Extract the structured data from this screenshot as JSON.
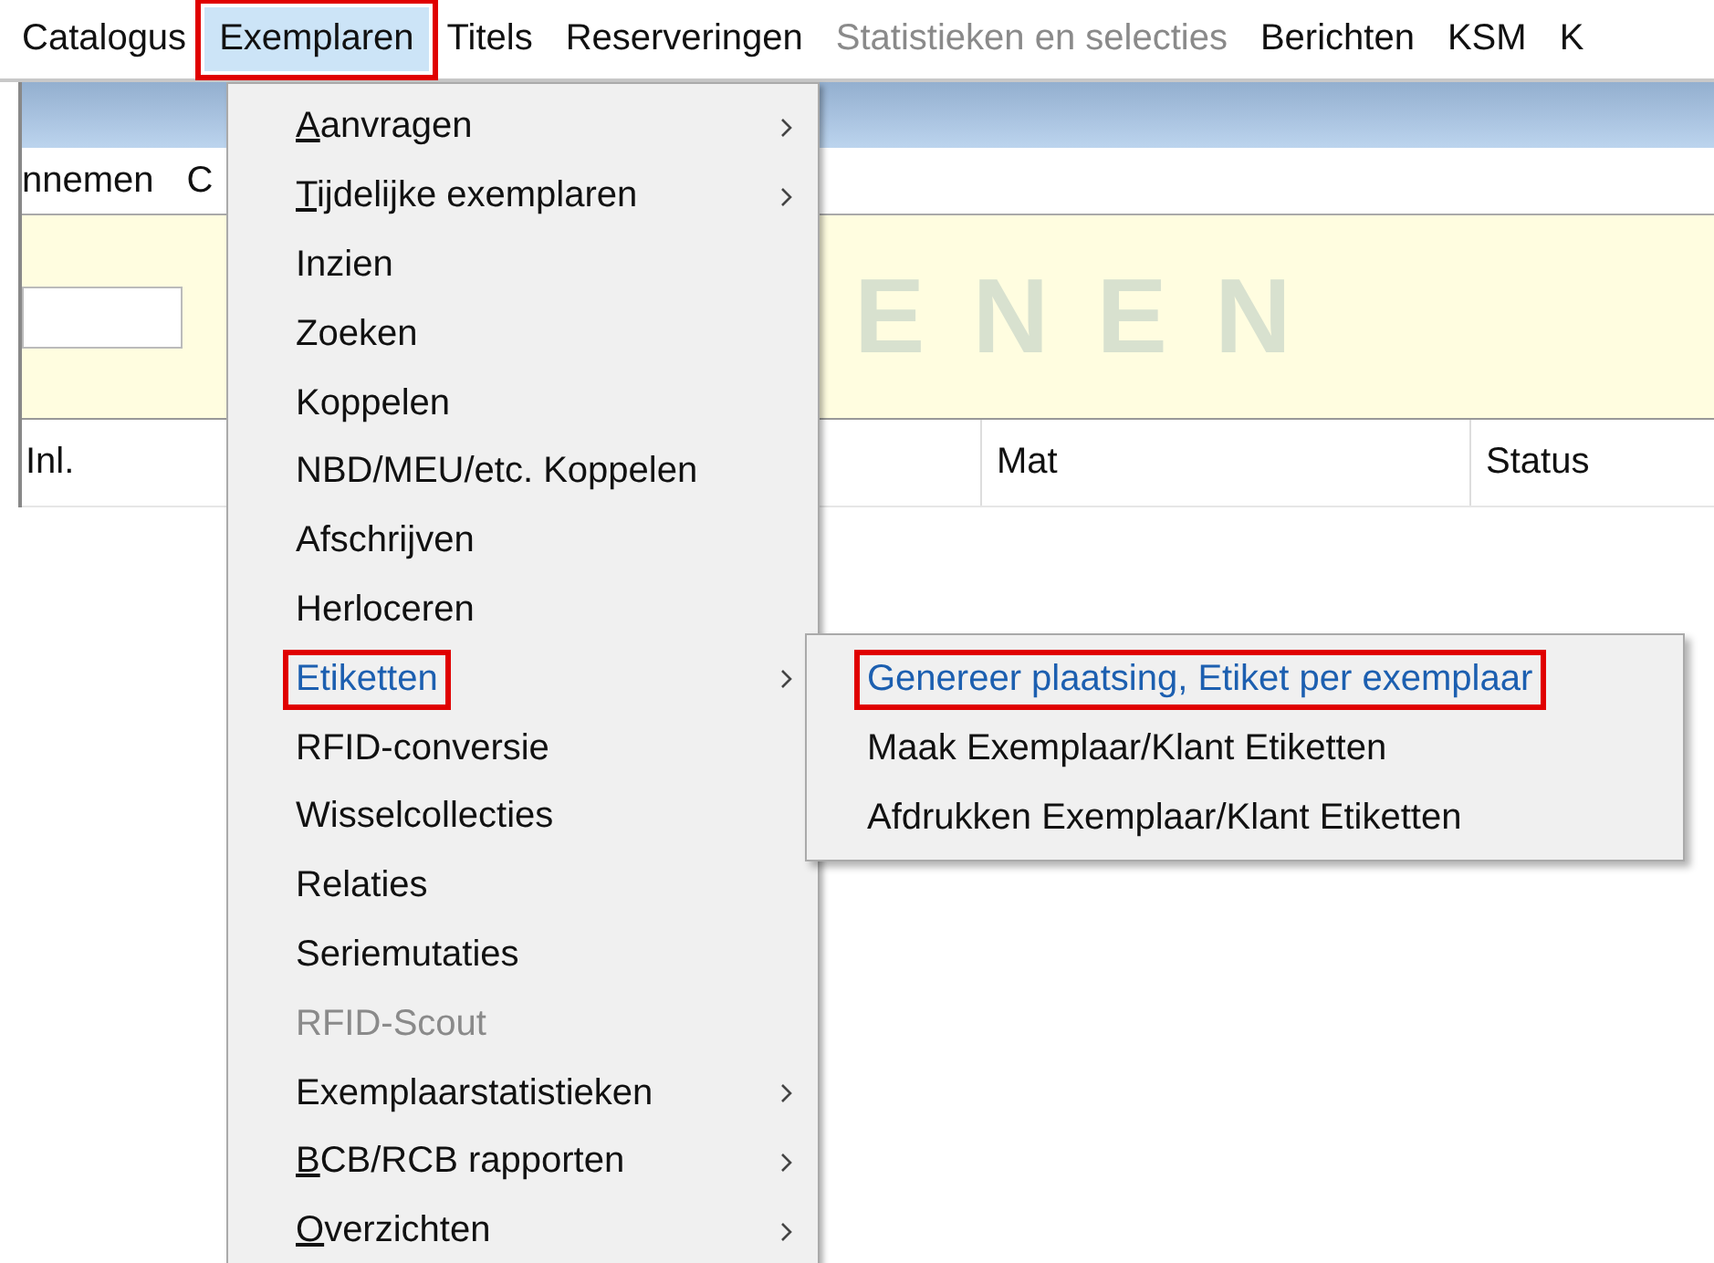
{
  "menubar": [
    {
      "label": "Catalogus",
      "selected": false,
      "disabled": false,
      "annotated": false
    },
    {
      "label": "Exemplaren",
      "selected": true,
      "disabled": false,
      "annotated": true
    },
    {
      "label": "Titels",
      "selected": false,
      "disabled": false,
      "annotated": false
    },
    {
      "label": "Reserveringen",
      "selected": false,
      "disabled": false,
      "annotated": false
    },
    {
      "label": "Statistieken en selecties",
      "selected": false,
      "disabled": true,
      "annotated": false
    },
    {
      "label": "Berichten",
      "selected": false,
      "disabled": false,
      "annotated": false
    },
    {
      "label": "KSM",
      "selected": false,
      "disabled": false,
      "annotated": false
    },
    {
      "label": "K",
      "selected": false,
      "disabled": false,
      "annotated": false
    }
  ],
  "toolbar": {
    "items": [
      "nnemen",
      "C"
    ]
  },
  "banner": {
    "watermark": "ENEN"
  },
  "table": {
    "columns": [
      "Inl.",
      "Mat",
      "Status"
    ]
  },
  "menu": {
    "items": [
      {
        "label": "Aanvragen",
        "underline_first": true,
        "submenu": true,
        "disabled": false,
        "selected": false,
        "annotated": false
      },
      {
        "label": "Tijdelijke exemplaren",
        "underline_first": true,
        "submenu": true,
        "disabled": false,
        "selected": false,
        "annotated": false
      },
      {
        "label": "Inzien",
        "underline_first": false,
        "submenu": false,
        "disabled": false,
        "selected": false,
        "annotated": false
      },
      {
        "label": "Zoeken",
        "underline_first": false,
        "submenu": false,
        "disabled": false,
        "selected": false,
        "annotated": false
      },
      {
        "label": "Koppelen",
        "underline_first": false,
        "submenu": false,
        "disabled": false,
        "selected": false,
        "annotated": false
      },
      {
        "label": "NBD/MEU/etc. Koppelen",
        "underline_first": false,
        "submenu": false,
        "disabled": false,
        "selected": false,
        "annotated": false
      },
      {
        "label": "Afschrijven",
        "underline_first": false,
        "submenu": false,
        "disabled": false,
        "selected": false,
        "annotated": false
      },
      {
        "label": "Herloceren",
        "underline_first": false,
        "submenu": false,
        "disabled": false,
        "selected": false,
        "annotated": false
      },
      {
        "label": "Etiketten",
        "underline_first": false,
        "submenu": true,
        "disabled": false,
        "selected": true,
        "annotated": true
      },
      {
        "label": "RFID-conversie",
        "underline_first": false,
        "submenu": false,
        "disabled": false,
        "selected": false,
        "annotated": false
      },
      {
        "label": "Wisselcollecties",
        "underline_first": false,
        "submenu": false,
        "disabled": false,
        "selected": false,
        "annotated": false
      },
      {
        "label": "Relaties",
        "underline_first": false,
        "submenu": false,
        "disabled": false,
        "selected": false,
        "annotated": false
      },
      {
        "label": "Seriemutaties",
        "underline_first": false,
        "submenu": false,
        "disabled": false,
        "selected": false,
        "annotated": false
      },
      {
        "label": "RFID-Scout",
        "underline_first": false,
        "submenu": false,
        "disabled": true,
        "selected": false,
        "annotated": false
      },
      {
        "label": "Exemplaarstatistieken",
        "underline_first": false,
        "submenu": true,
        "disabled": false,
        "selected": false,
        "annotated": false
      },
      {
        "label": "BCB/RCB rapporten",
        "underline_first": true,
        "submenu": true,
        "disabled": false,
        "selected": false,
        "annotated": false
      },
      {
        "label": "Overzichten",
        "underline_first": true,
        "submenu": true,
        "disabled": false,
        "selected": false,
        "annotated": false
      }
    ]
  },
  "submenu": {
    "items": [
      {
        "label": "Genereer plaatsing, Etiket per exemplaar",
        "selected": true,
        "disabled": false,
        "annotated": true
      },
      {
        "label": "Maak Exemplaar/Klant Etiketten",
        "selected": false,
        "disabled": false,
        "annotated": false
      },
      {
        "label": "Afdrukken Exemplaar/Klant Etiketten",
        "selected": false,
        "disabled": false,
        "annotated": false
      }
    ]
  }
}
